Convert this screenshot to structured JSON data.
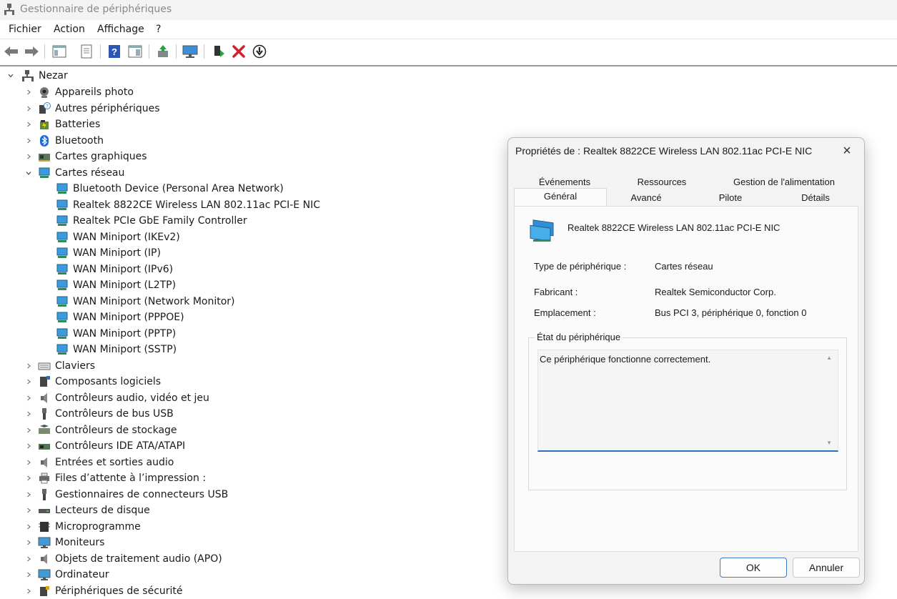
{
  "window": {
    "title": "Gestionnaire de périphériques"
  },
  "menu": [
    "Fichier",
    "Action",
    "Affichage",
    "?"
  ],
  "toolbar": {
    "icons": [
      "back-icon",
      "forward-icon",
      "properties-pane-icon",
      "show-hidden-icon",
      "help-icon",
      "console-tree-icon",
      "update-driver-icon",
      "scan-hardware-icon",
      "enable-device-icon",
      "uninstall-device-icon",
      "disable-device-icon"
    ],
    "uninstall_color": "#d0202b"
  },
  "tree": {
    "root": "Nezar",
    "categories": [
      {
        "label": "Appareils photo",
        "icon": "camera-icon"
      },
      {
        "label": "Autres périphériques",
        "icon": "unknown-device-icon"
      },
      {
        "label": "Batteries",
        "icon": "battery-icon"
      },
      {
        "label": "Bluetooth",
        "icon": "bluetooth-icon"
      },
      {
        "label": "Cartes graphiques",
        "icon": "display-adapter-icon"
      },
      {
        "label": "Cartes réseau",
        "icon": "network-adapter-icon",
        "expanded": true,
        "children": [
          "Bluetooth Device (Personal Area Network)",
          "Realtek 8822CE Wireless LAN 802.11ac PCI-E NIC",
          "Realtek PCIe GbE Family Controller",
          "WAN Miniport (IKEv2)",
          "WAN Miniport (IP)",
          "WAN Miniport (IPv6)",
          "WAN Miniport (L2TP)",
          "WAN Miniport (Network Monitor)",
          "WAN Miniport (PPPOE)",
          "WAN Miniport (PPTP)",
          "WAN Miniport (SSTP)"
        ]
      },
      {
        "label": "Claviers",
        "icon": "keyboard-icon"
      },
      {
        "label": "Composants logiciels",
        "icon": "software-component-icon"
      },
      {
        "label": "Contrôleurs audio, vidéo et jeu",
        "icon": "speaker-icon"
      },
      {
        "label": "Contrôleurs de bus USB",
        "icon": "usb-icon"
      },
      {
        "label": "Contrôleurs de stockage",
        "icon": "storage-controller-icon"
      },
      {
        "label": "Contrôleurs IDE ATA/ATAPI",
        "icon": "ide-controller-icon"
      },
      {
        "label": "Entrées et sorties audio",
        "icon": "speaker-icon"
      },
      {
        "label": "Files d’attente à l’impression :",
        "icon": "printer-icon"
      },
      {
        "label": "Gestionnaires de connecteurs USB",
        "icon": "usb-icon"
      },
      {
        "label": "Lecteurs de disque",
        "icon": "disk-drive-icon"
      },
      {
        "label": "Microprogramme",
        "icon": "firmware-icon"
      },
      {
        "label": "Moniteurs",
        "icon": "monitor-icon"
      },
      {
        "label": "Objets de traitement audio (APO)",
        "icon": "speaker-icon"
      },
      {
        "label": "Ordinateur",
        "icon": "computer-icon"
      },
      {
        "label": "Périphériques de sécurité",
        "icon": "security-device-icon"
      }
    ]
  },
  "dialog": {
    "title": "Propriétés de : Realtek 8822CE Wireless LAN 802.11ac PCI-E NIC",
    "tabs_row1": [
      "Événements",
      "Ressources",
      "Gestion de l'alimentation"
    ],
    "tabs_row2": [
      "Général",
      "Avancé",
      "Pilote",
      "Détails"
    ],
    "active_tab": "Général",
    "device_name": "Realtek 8822CE Wireless LAN 802.11ac PCI-E NIC",
    "fields": [
      {
        "label": "Type de périphérique :",
        "value": "Cartes réseau"
      },
      {
        "label": "Fabricant :",
        "value": "Realtek Semiconductor Corp."
      },
      {
        "label": "Emplacement :",
        "value": "Bus PCI 3, périphérique 0, fonction 0"
      }
    ],
    "status_legend": "État du périphérique",
    "status_text": "Ce périphérique fonctionne correctement.",
    "ok_label": "OK",
    "cancel_label": "Annuler"
  }
}
